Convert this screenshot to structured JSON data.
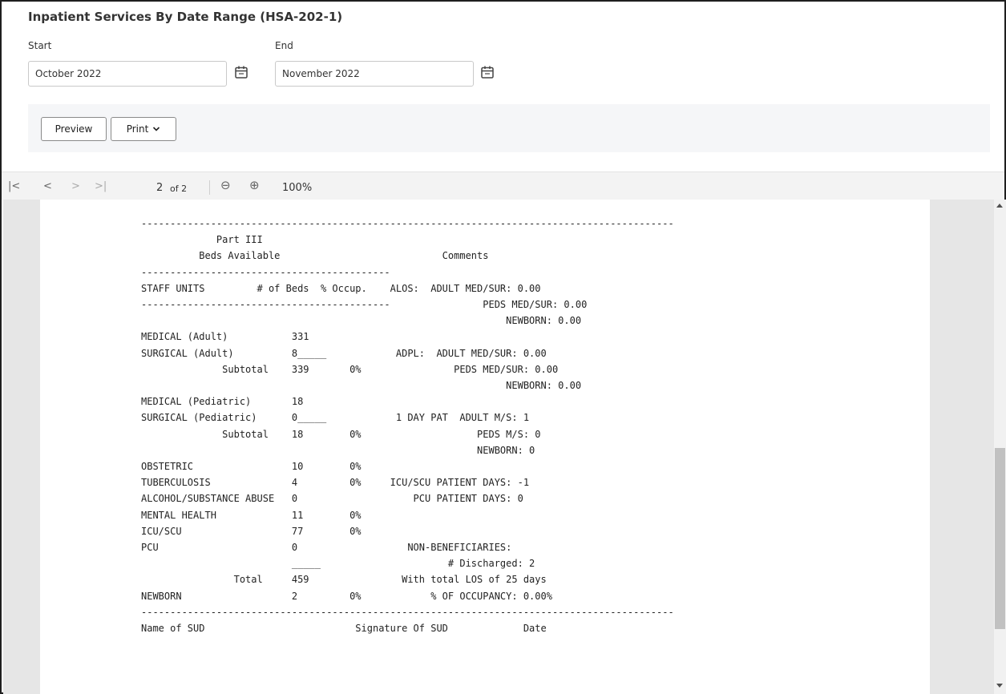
{
  "header": {
    "title": "Inpatient Services By Date Range (HSA-202-1)"
  },
  "filters": {
    "start_label": "Start",
    "start_value": "October 2022",
    "end_label": "End",
    "end_value": "November 2022"
  },
  "actions": {
    "preview_label": "Preview",
    "print_label": "Print"
  },
  "toolbar": {
    "first_icon": "|<",
    "prev_icon": "<",
    "next_icon": ">",
    "last_icon": ">|",
    "current_page": "2",
    "page_total": "of 2",
    "zoom_out_icon": "⊖",
    "zoom_in_icon": "⊕",
    "zoom": "100%"
  },
  "report": {
    "lines": [
      "--------------------------------------------------------------------------------------------",
      "             Part III",
      "          Beds Available                            Comments",
      "-------------------------------------------",
      "STAFF UNITS         # of Beds  % Occup.    ALOS:  ADULT MED/SUR: 0.00",
      "-------------------------------------------                PEDS MED/SUR: 0.00",
      "                                                               NEWBORN: 0.00",
      "MEDICAL (Adult)           331",
      "SURGICAL (Adult)          8_____            ADPL:  ADULT MED/SUR: 0.00",
      "              Subtotal    339       0%                PEDS MED/SUR: 0.00",
      "                                                               NEWBORN: 0.00",
      "MEDICAL (Pediatric)       18",
      "SURGICAL (Pediatric)      0_____            1 DAY PAT  ADULT M/S: 1",
      "              Subtotal    18        0%                    PEDS M/S: 0",
      "                                                          NEWBORN: 0",
      "OBSTETRIC                 10        0%",
      "TUBERCULOSIS              4         0%     ICU/SCU PATIENT DAYS: -1",
      "ALCOHOL/SUBSTANCE ABUSE   0                    PCU PATIENT DAYS: 0",
      "MENTAL HEALTH             11        0%",
      "ICU/SCU                   77        0%",
      "PCU                       0                   NON-BENEFICIARIES:",
      "                          _____                      # Discharged: 2",
      "                Total     459                With total LOS of 25 days",
      "NEWBORN                   2         0%            % OF OCCUPANCY: 0.00%",
      "--------------------------------------------------------------------------------------------",
      "Name of SUD                          Signature Of SUD             Date"
    ]
  }
}
